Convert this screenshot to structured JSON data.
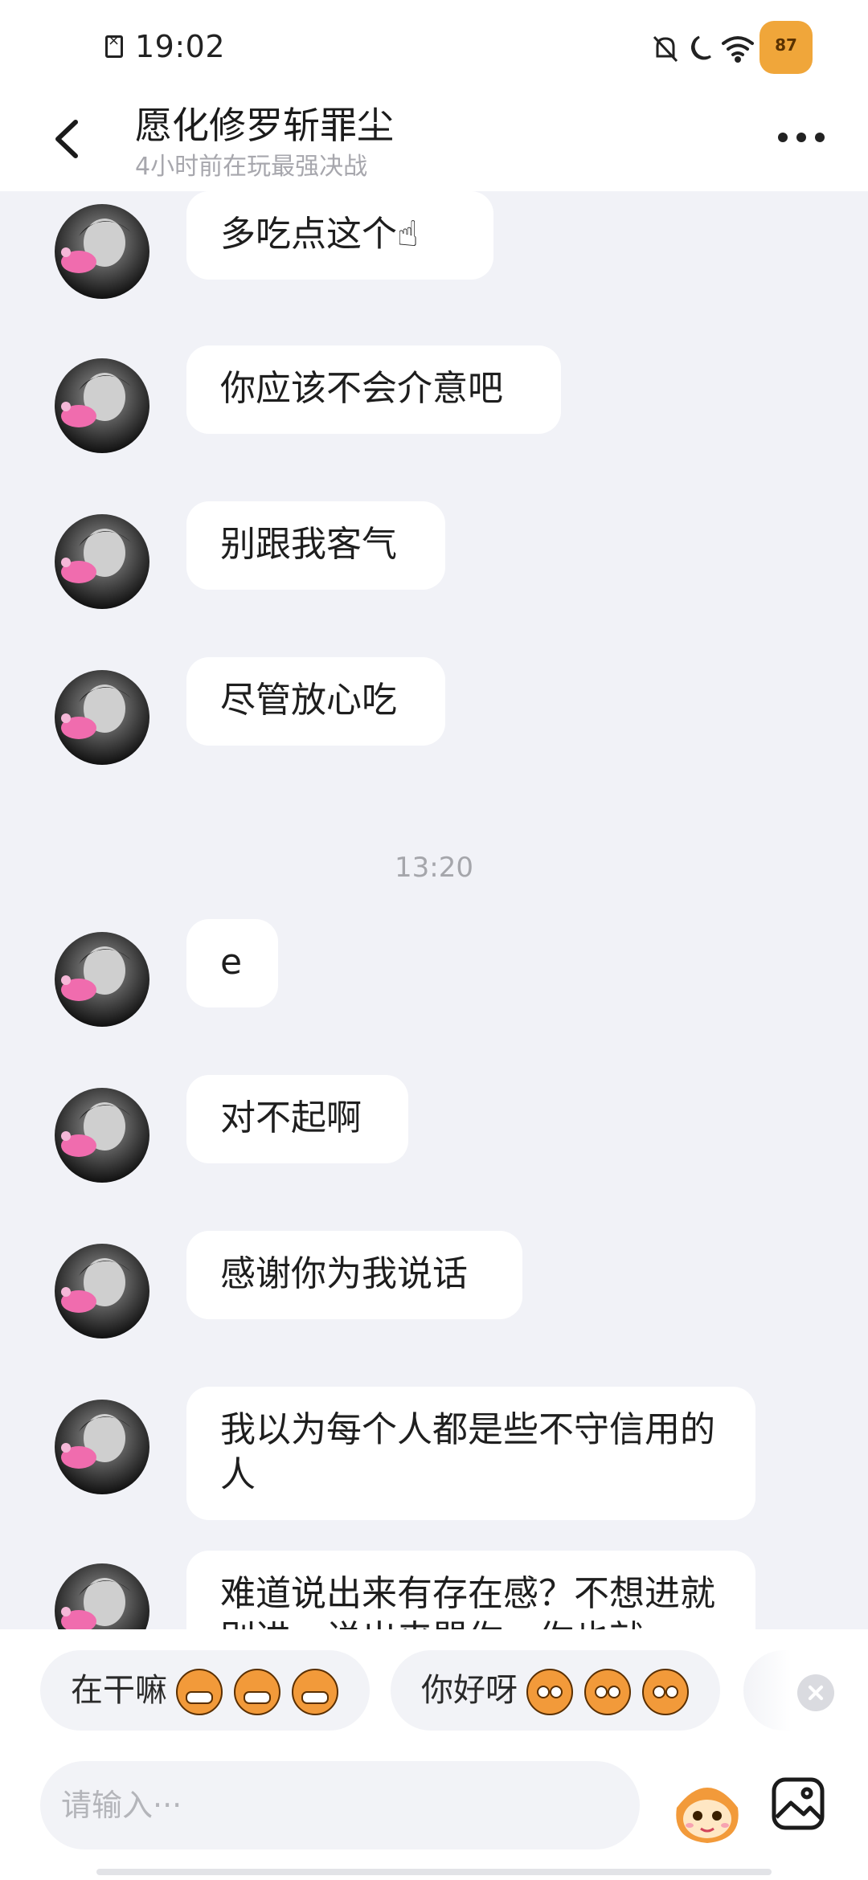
{
  "status_bar": {
    "time": "19:02",
    "battery_level": "87",
    "icons": [
      "sim-error-icon",
      "mute-bell-icon",
      "moon-icon",
      "wifi-icon",
      "battery-icon"
    ]
  },
  "header": {
    "title": "愿化修罗斩罪尘",
    "subtitle": "4小时前在玩最强决战",
    "back_icon": "chevron-left-icon",
    "more_icon": "more-dots-icon"
  },
  "messages": [
    {
      "text": "多吃点这个",
      "emoji": "pointing-hand-icon"
    },
    {
      "text": "你应该不会介意吧"
    },
    {
      "text": "别跟我客气"
    },
    {
      "text": "尽管放心吃"
    },
    {
      "timestamp": "13:20"
    },
    {
      "text": "e"
    },
    {
      "text": "对不起啊"
    },
    {
      "text": "感谢你为我说话"
    },
    {
      "text": "我以为每个人都是些不守信用的人"
    },
    {
      "text": "难道说出来有存在感？不想进就别进，说出来骂你，你也就"
    }
  ],
  "quick_replies": [
    {
      "label": "在干嘛",
      "emoji_count": 3
    },
    {
      "label": "你好呀",
      "emoji_count": 3
    }
  ],
  "input": {
    "placeholder": "请输入···"
  },
  "colors": {
    "background": "#f1f2f7",
    "bubble": "#ffffff",
    "battery": "#f0a63a",
    "sticker_orange": "#f29a3a"
  }
}
